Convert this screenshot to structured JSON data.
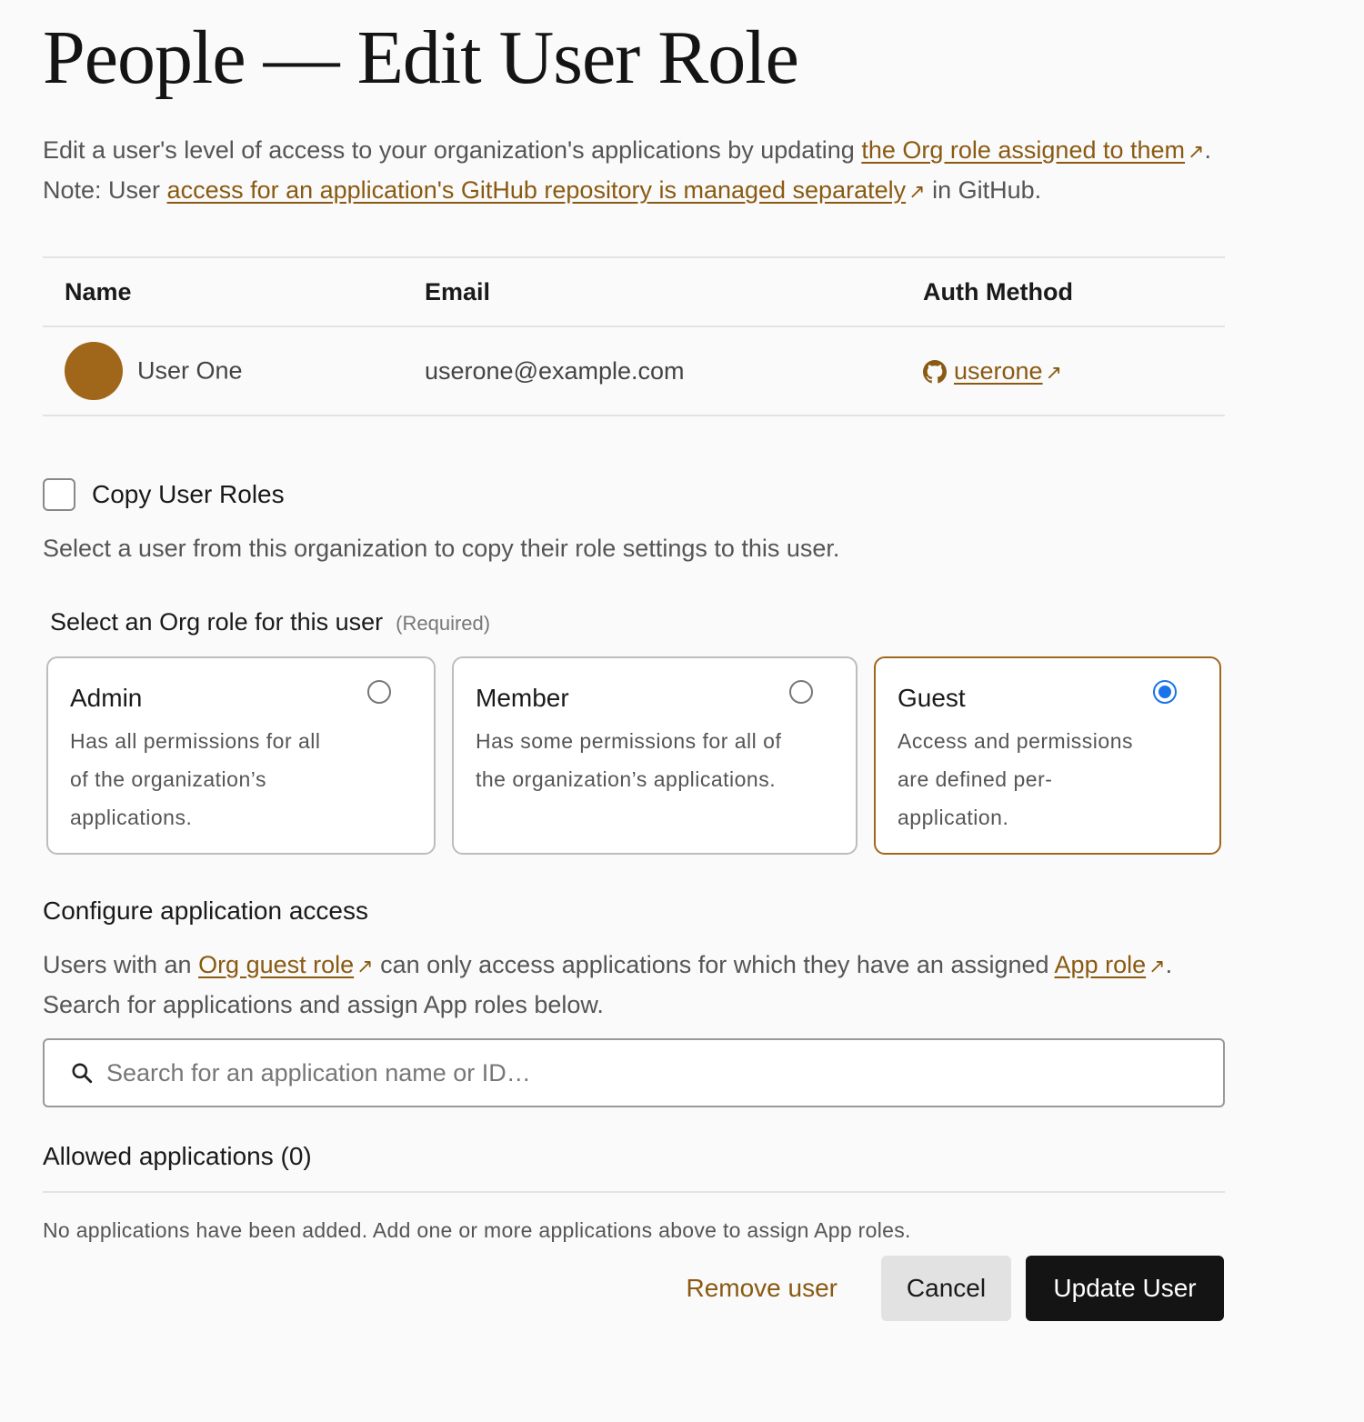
{
  "page": {
    "title": "People — Edit User Role",
    "intro_line1_text": "Edit a user's level of access to your organization's applications by updating ",
    "intro_line1_link": "the Org role assigned to them",
    "intro_line1_end": ".",
    "intro_line2_text": "Note: User ",
    "intro_line2_link": "access for an application's GitHub repository is managed separately",
    "intro_line2_end": " in GitHub.",
    "external_arrow": "↗"
  },
  "users_table": {
    "columns": [
      "Name",
      "Email",
      "Auth Method"
    ],
    "row": {
      "name": "User One",
      "email": "userone@example.com",
      "auth_icon": "github-icon",
      "auth_link": "userone"
    }
  },
  "copy_roles": {
    "label": "Copy User Roles",
    "checked": false,
    "help": "Select a user from this organization to copy their role settings to this user."
  },
  "org_role": {
    "heading": "Select an Org role for this user",
    "required": "(Required)",
    "selected": "Guest",
    "options": [
      {
        "label": "Admin",
        "desc": "Has all permissions for all of the organization’s applications."
      },
      {
        "label": "Member",
        "desc": "Has some permissions for all of the organization’s applications."
      },
      {
        "label": "Guest",
        "desc": "Access and permissions are defined per-application."
      }
    ]
  },
  "configure": {
    "heading": "Configure application access",
    "desc_before": "Users with an ",
    "link1": "Org guest role",
    "desc_mid": " can only access applications for which they have an assigned ",
    "link2": "App role",
    "desc_after": ". Search for applications and assign App roles below.",
    "search_placeholder": "Search for an application name or ID…"
  },
  "allowed": {
    "heading": "Allowed applications (0)",
    "empty": "No applications have been added. Add one or more applications above to assign App roles."
  },
  "actions": {
    "remove": "Remove user",
    "cancel": "Cancel",
    "update": "Update User"
  },
  "colors": {
    "accent": "#8a5a12",
    "avatar": "#a0661a",
    "radio_selected": "#1a73e8",
    "primary_button": "#141414"
  }
}
